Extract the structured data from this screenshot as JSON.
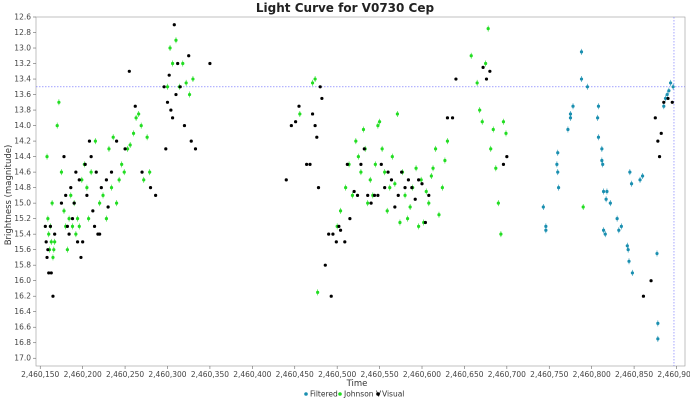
{
  "chart_data": {
    "type": "scatter",
    "title": "Light Curve for V0730 Cep",
    "xlabel": "Time",
    "ylabel": "Brightness (magnitude)",
    "xlim": [
      2460145,
      2460910
    ],
    "ylim": [
      17.1,
      12.6
    ],
    "y_inverted": true,
    "grid": false,
    "legend_position": "bottom",
    "crosshair": {
      "x": 2460897,
      "y": 13.5
    },
    "x_ticks": [
      2460150,
      2460200,
      2460250,
      2460300,
      2460350,
      2460400,
      2460450,
      2460500,
      2460550,
      2460600,
      2460650,
      2460700,
      2460750,
      2460800,
      2460850,
      2460900
    ],
    "x_tick_labels": [
      "2,460,150",
      "2,460,200",
      "2,460,250",
      "2,460,300",
      "2,460,350",
      "2,460,400",
      "2,460,450",
      "2,460,500",
      "2,460,550",
      "2,460,600",
      "2,460,650",
      "2,460,700",
      "2,460,750",
      "2,460,800",
      "2,460,850",
      "2,460,900"
    ],
    "y_ticks": [
      12.6,
      12.8,
      13.0,
      13.2,
      13.4,
      13.6,
      13.8,
      14.0,
      14.2,
      14.4,
      14.6,
      14.8,
      15.0,
      15.2,
      15.4,
      15.6,
      15.8,
      16.0,
      16.2,
      16.4,
      16.6,
      16.8,
      17.0
    ],
    "y_tick_labels": [
      "12.6",
      "12.8",
      "13.0",
      "13.2",
      "13.4",
      "13.6",
      "13.8",
      "14.0",
      "14.2",
      "14.4",
      "14.6",
      "14.8",
      "15.0",
      "15.2",
      "15.4",
      "15.6",
      "15.8",
      "16.0",
      "16.2",
      "16.4",
      "16.6",
      "16.8",
      "17.0"
    ],
    "series": [
      {
        "name": "Filtered",
        "color": "#1a8fb0",
        "points": [
          [
            2460743,
            15.05
          ],
          [
            2460746,
            15.3
          ],
          [
            2460746,
            15.35
          ],
          [
            2460759,
            14.5
          ],
          [
            2460760,
            14.35
          ],
          [
            2460760,
            14.6
          ],
          [
            2460761,
            14.8
          ],
          [
            2460772,
            14.05
          ],
          [
            2460775,
            13.9
          ],
          [
            2460775,
            13.85
          ],
          [
            2460778,
            13.75
          ],
          [
            2460788,
            13.05
          ],
          [
            2460788,
            13.4
          ],
          [
            2460795,
            13.5
          ],
          [
            2460807,
            13.9
          ],
          [
            2460808,
            13.75
          ],
          [
            2460808,
            14.15
          ],
          [
            2460812,
            14.3
          ],
          [
            2460812,
            14.45
          ],
          [
            2460813,
            14.5
          ],
          [
            2460814,
            14.85
          ],
          [
            2460814,
            15.35
          ],
          [
            2460816,
            15.4
          ],
          [
            2460817,
            14.95
          ],
          [
            2460818,
            14.85
          ],
          [
            2460822,
            15.0
          ],
          [
            2460830,
            15.2
          ],
          [
            2460832,
            15.35
          ],
          [
            2460835,
            15.3
          ],
          [
            2460842,
            15.55
          ],
          [
            2460843,
            15.6
          ],
          [
            2460844,
            15.75
          ],
          [
            2460845,
            14.6
          ],
          [
            2460847,
            14.75
          ],
          [
            2460848,
            15.9
          ],
          [
            2460857,
            14.7
          ],
          [
            2460860,
            14.65
          ],
          [
            2460877,
            15.65
          ],
          [
            2460878,
            16.55
          ],
          [
            2460878,
            16.75
          ],
          [
            2460885,
            13.75
          ],
          [
            2460887,
            13.65
          ],
          [
            2460889,
            13.6
          ],
          [
            2460891,
            13.55
          ],
          [
            2460893,
            13.45
          ],
          [
            2460896,
            13.5
          ]
        ]
      },
      {
        "name": "Johnson V",
        "color": "#22dd22",
        "points": [
          [
            2460158,
            14.4
          ],
          [
            2460159,
            15.2
          ],
          [
            2460160,
            15.4
          ],
          [
            2460161,
            15.6
          ],
          [
            2460162,
            15.3
          ],
          [
            2460163,
            15.5
          ],
          [
            2460164,
            15.0
          ],
          [
            2460165,
            15.7
          ],
          [
            2460166,
            15.6
          ],
          [
            2460167,
            15.5
          ],
          [
            2460170,
            14.0
          ],
          [
            2460172,
            13.7
          ],
          [
            2460175,
            14.6
          ],
          [
            2460178,
            15.1
          ],
          [
            2460180,
            15.3
          ],
          [
            2460182,
            15.6
          ],
          [
            2460184,
            15.2
          ],
          [
            2460186,
            14.9
          ],
          [
            2460188,
            15.3
          ],
          [
            2460190,
            15.0
          ],
          [
            2460192,
            15.4
          ],
          [
            2460194,
            15.2
          ],
          [
            2460196,
            15.3
          ],
          [
            2460199,
            14.7
          ],
          [
            2460202,
            14.5
          ],
          [
            2460205,
            14.8
          ],
          [
            2460207,
            15.2
          ],
          [
            2460210,
            14.6
          ],
          [
            2460215,
            14.2
          ],
          [
            2460220,
            15.0
          ],
          [
            2460224,
            14.9
          ],
          [
            2460228,
            15.2
          ],
          [
            2460231,
            14.3
          ],
          [
            2460234,
            14.8
          ],
          [
            2460236,
            14.15
          ],
          [
            2460240,
            15.0
          ],
          [
            2460243,
            14.7
          ],
          [
            2460246,
            14.5
          ],
          [
            2460249,
            14.6
          ],
          [
            2460253,
            14.3
          ],
          [
            2460256,
            14.25
          ],
          [
            2460260,
            14.1
          ],
          [
            2460263,
            13.9
          ],
          [
            2460266,
            13.85
          ],
          [
            2460269,
            14.0
          ],
          [
            2460272,
            14.7
          ],
          [
            2460276,
            14.15
          ],
          [
            2460279,
            14.6
          ],
          [
            2460300,
            13.5
          ],
          [
            2460303,
            13.0
          ],
          [
            2460306,
            13.2
          ],
          [
            2460310,
            12.9
          ],
          [
            2460314,
            13.5
          ],
          [
            2460318,
            13.2
          ],
          [
            2460322,
            13.45
          ],
          [
            2460326,
            13.6
          ],
          [
            2460330,
            13.4
          ],
          [
            2460456,
            13.85
          ],
          [
            2460471,
            13.45
          ],
          [
            2460474,
            13.4
          ],
          [
            2460477,
            16.15
          ],
          [
            2460500,
            15.3
          ],
          [
            2460504,
            15.1
          ],
          [
            2460510,
            14.8
          ],
          [
            2460514,
            14.5
          ],
          [
            2460518,
            14.9
          ],
          [
            2460522,
            14.2
          ],
          [
            2460525,
            14.4
          ],
          [
            2460528,
            14.6
          ],
          [
            2460531,
            14.05
          ],
          [
            2460533,
            14.3
          ],
          [
            2460536,
            15.0
          ],
          [
            2460539,
            14.7
          ],
          [
            2460542,
            14.9
          ],
          [
            2460545,
            14.5
          ],
          [
            2460548,
            14.0
          ],
          [
            2460550,
            13.95
          ],
          [
            2460553,
            14.3
          ],
          [
            2460556,
            14.6
          ],
          [
            2460559,
            15.1
          ],
          [
            2460562,
            14.8
          ],
          [
            2460565,
            14.4
          ],
          [
            2460568,
            14.75
          ],
          [
            2460571,
            13.85
          ],
          [
            2460574,
            15.25
          ],
          [
            2460577,
            14.6
          ],
          [
            2460580,
            14.9
          ],
          [
            2460583,
            15.2
          ],
          [
            2460586,
            15.05
          ],
          [
            2460589,
            14.8
          ],
          [
            2460593,
            14.55
          ],
          [
            2460596,
            15.3
          ],
          [
            2460599,
            14.7
          ],
          [
            2460602,
            15.25
          ],
          [
            2460605,
            14.85
          ],
          [
            2460608,
            15.0
          ],
          [
            2460611,
            14.65
          ],
          [
            2460613,
            14.55
          ],
          [
            2460616,
            14.3
          ],
          [
            2460620,
            15.15
          ],
          [
            2460624,
            14.8
          ],
          [
            2460627,
            14.45
          ],
          [
            2460630,
            14.2
          ],
          [
            2460658,
            13.1
          ],
          [
            2460665,
            13.45
          ],
          [
            2460668,
            13.8
          ],
          [
            2460671,
            13.95
          ],
          [
            2460675,
            13.2
          ],
          [
            2460678,
            12.75
          ],
          [
            2460681,
            14.3
          ],
          [
            2460684,
            14.05
          ],
          [
            2460687,
            14.55
          ],
          [
            2460690,
            15.0
          ],
          [
            2460693,
            15.4
          ],
          [
            2460696,
            13.95
          ],
          [
            2460699,
            14.1
          ],
          [
            2460790,
            15.05
          ]
        ]
      },
      {
        "name": "Visual",
        "color": "#000000",
        "points": [
          [
            2460156,
            15.3
          ],
          [
            2460157,
            15.5
          ],
          [
            2460158,
            15.7
          ],
          [
            2460159,
            15.6
          ],
          [
            2460160,
            15.9
          ],
          [
            2460162,
            15.3
          ],
          [
            2460163,
            15.9
          ],
          [
            2460165,
            16.2
          ],
          [
            2460167,
            15.4
          ],
          [
            2460175,
            15.0
          ],
          [
            2460178,
            14.4
          ],
          [
            2460180,
            14.9
          ],
          [
            2460182,
            15.3
          ],
          [
            2460184,
            15.4
          ],
          [
            2460186,
            14.8
          ],
          [
            2460188,
            15.2
          ],
          [
            2460190,
            15.0
          ],
          [
            2460192,
            14.6
          ],
          [
            2460194,
            15.5
          ],
          [
            2460196,
            14.7
          ],
          [
            2460198,
            15.7
          ],
          [
            2460200,
            15.5
          ],
          [
            2460203,
            14.5
          ],
          [
            2460205,
            14.9
          ],
          [
            2460208,
            14.2
          ],
          [
            2460210,
            14.4
          ],
          [
            2460212,
            15.1
          ],
          [
            2460214,
            15.3
          ],
          [
            2460216,
            14.6
          ],
          [
            2460218,
            15.4
          ],
          [
            2460220,
            15.4
          ],
          [
            2460222,
            14.8
          ],
          [
            2460228,
            14.7
          ],
          [
            2460230,
            15.05
          ],
          [
            2460234,
            14.6
          ],
          [
            2460240,
            14.2
          ],
          [
            2460250,
            14.3
          ],
          [
            2460255,
            13.3
          ],
          [
            2460262,
            13.75
          ],
          [
            2460270,
            14.6
          ],
          [
            2460280,
            14.8
          ],
          [
            2460286,
            14.9
          ],
          [
            2460296,
            13.5
          ],
          [
            2460298,
            14.3
          ],
          [
            2460300,
            13.7
          ],
          [
            2460302,
            13.35
          ],
          [
            2460304,
            13.8
          ],
          [
            2460306,
            13.9
          ],
          [
            2460308,
            12.7
          ],
          [
            2460310,
            13.6
          ],
          [
            2460312,
            13.2
          ],
          [
            2460315,
            13.5
          ],
          [
            2460320,
            14.0
          ],
          [
            2460325,
            13.1
          ],
          [
            2460328,
            14.2
          ],
          [
            2460333,
            14.3
          ],
          [
            2460350,
            13.2
          ],
          [
            2460440,
            14.7
          ],
          [
            2460446,
            14.0
          ],
          [
            2460451,
            13.95
          ],
          [
            2460455,
            13.75
          ],
          [
            2460464,
            14.5
          ],
          [
            2460468,
            14.5
          ],
          [
            2460471,
            13.85
          ],
          [
            2460474,
            14.0
          ],
          [
            2460476,
            14.15
          ],
          [
            2460478,
            14.8
          ],
          [
            2460480,
            13.5
          ],
          [
            2460482,
            13.65
          ],
          [
            2460486,
            15.8
          ],
          [
            2460490,
            15.4
          ],
          [
            2460493,
            16.2
          ],
          [
            2460495,
            15.4
          ],
          [
            2460499,
            15.5
          ],
          [
            2460502,
            15.3
          ],
          [
            2460504,
            15.35
          ],
          [
            2460509,
            15.5
          ],
          [
            2460512,
            14.5
          ],
          [
            2460515,
            15.2
          ],
          [
            2460520,
            14.85
          ],
          [
            2460524,
            14.9
          ],
          [
            2460528,
            14.5
          ],
          [
            2460532,
            14.3
          ],
          [
            2460536,
            14.9
          ],
          [
            2460540,
            15.0
          ],
          [
            2460544,
            14.9
          ],
          [
            2460548,
            14.9
          ],
          [
            2460552,
            14.5
          ],
          [
            2460556,
            14.8
          ],
          [
            2460560,
            14.6
          ],
          [
            2460564,
            14.7
          ],
          [
            2460568,
            15.05
          ],
          [
            2460572,
            14.9
          ],
          [
            2460576,
            14.6
          ],
          [
            2460580,
            14.8
          ],
          [
            2460584,
            14.7
          ],
          [
            2460588,
            14.8
          ],
          [
            2460592,
            14.95
          ],
          [
            2460596,
            14.7
          ],
          [
            2460600,
            14.75
          ],
          [
            2460604,
            15.25
          ],
          [
            2460608,
            14.9
          ],
          [
            2460630,
            13.9
          ],
          [
            2460636,
            13.9
          ],
          [
            2460640,
            13.4
          ],
          [
            2460672,
            13.25
          ],
          [
            2460676,
            13.4
          ],
          [
            2460680,
            13.3
          ],
          [
            2460696,
            14.5
          ],
          [
            2460700,
            14.4
          ],
          [
            2460870,
            16.0
          ],
          [
            2460875,
            13.9
          ],
          [
            2460878,
            14.2
          ],
          [
            2460880,
            14.4
          ],
          [
            2460882,
            14.1
          ],
          [
            2460885,
            13.7
          ],
          [
            2460890,
            13.65
          ],
          [
            2460895,
            13.7
          ],
          [
            2460861,
            16.2
          ]
        ]
      }
    ]
  }
}
